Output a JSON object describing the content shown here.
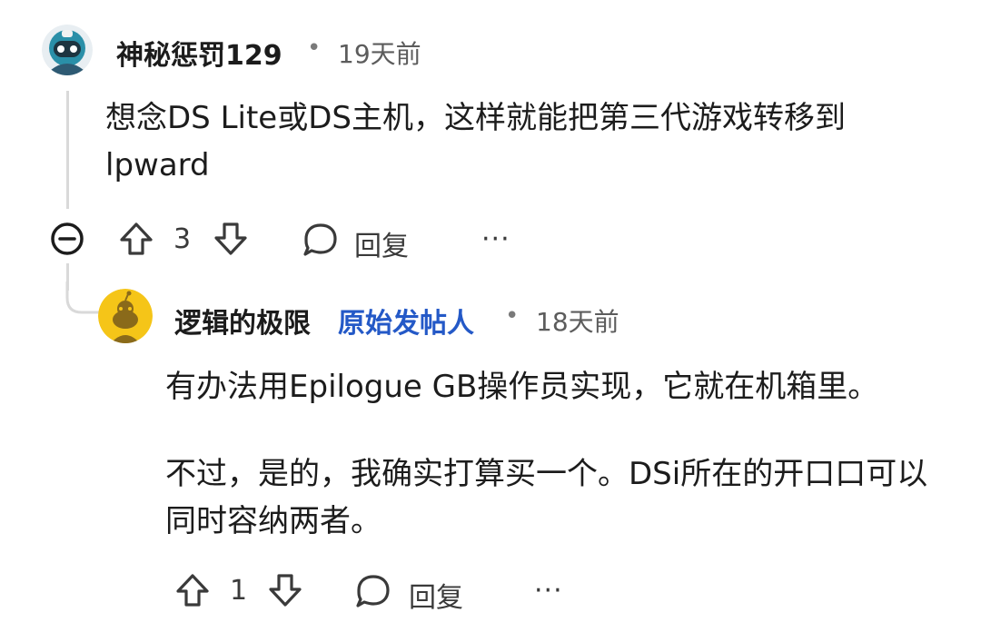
{
  "comment": {
    "username": "神秘惩罚129",
    "separator": "•",
    "timestamp": "19天前",
    "body": "想念DS Lite或DS主机，这样就能把第三代游戏转移到lpward",
    "votes": "3",
    "reply_label": "回复",
    "more_label": "···",
    "avatar_icon": "robot-avatar-icon",
    "collapse_icon": "collapse-minus-icon"
  },
  "reply": {
    "username": "逻辑的极限",
    "op_badge": "原始发帖人",
    "separator": "•",
    "timestamp": "18天前",
    "body_paragraphs": [
      "有办法用Epilogue GB操作员实现，它就在机箱里。",
      "不过，是的，我确实打算买一个。DSi所在的开口口可以同时容纳两者。"
    ],
    "votes": "1",
    "reply_label": "回复",
    "more_label": "···",
    "avatar_icon": "snoo-avatar-icon"
  },
  "colors": {
    "op_badge": "#2459c7",
    "avatar_yellow": "#f5c518",
    "thread_line": "#d9d9d9"
  }
}
